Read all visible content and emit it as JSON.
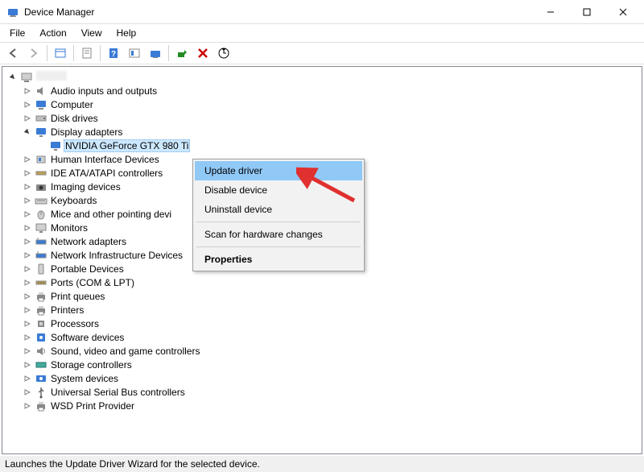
{
  "title": "Device Manager",
  "menus": [
    "File",
    "Action",
    "View",
    "Help"
  ],
  "tree": {
    "root_label": "",
    "items": [
      {
        "label": "Audio inputs and outputs",
        "icon": "speaker-icon"
      },
      {
        "label": "Computer",
        "icon": "computer-icon"
      },
      {
        "label": "Disk drives",
        "icon": "disk-icon"
      },
      {
        "label": "Display adapters",
        "icon": "display-icon",
        "expanded": true,
        "children": [
          {
            "label": "NVIDIA GeForce GTX 980 Ti",
            "icon": "display-icon",
            "selected": true
          }
        ]
      },
      {
        "label": "Human Interface Devices",
        "icon": "hid-icon"
      },
      {
        "label": "IDE ATA/ATAPI controllers",
        "icon": "ide-icon"
      },
      {
        "label": "Imaging devices",
        "icon": "camera-icon"
      },
      {
        "label": "Keyboards",
        "icon": "keyboard-icon"
      },
      {
        "label": "Mice and other pointing devi",
        "icon": "mouse-icon"
      },
      {
        "label": "Monitors",
        "icon": "monitor-icon"
      },
      {
        "label": "Network adapters",
        "icon": "network-icon"
      },
      {
        "label": "Network Infrastructure Devices",
        "icon": "network-icon"
      },
      {
        "label": "Portable Devices",
        "icon": "portable-icon"
      },
      {
        "label": "Ports (COM & LPT)",
        "icon": "port-icon"
      },
      {
        "label": "Print queues",
        "icon": "printer-icon"
      },
      {
        "label": "Printers",
        "icon": "printer-icon"
      },
      {
        "label": "Processors",
        "icon": "cpu-icon"
      },
      {
        "label": "Software devices",
        "icon": "software-icon"
      },
      {
        "label": "Sound, video and game controllers",
        "icon": "sound-icon"
      },
      {
        "label": "Storage controllers",
        "icon": "storage-icon"
      },
      {
        "label": "System devices",
        "icon": "system-icon"
      },
      {
        "label": "Universal Serial Bus controllers",
        "icon": "usb-icon"
      },
      {
        "label": "WSD Print Provider",
        "icon": "printer-icon"
      }
    ]
  },
  "context_menu": {
    "items": [
      {
        "label": "Update driver",
        "highlight": true
      },
      {
        "label": "Disable device"
      },
      {
        "label": "Uninstall device"
      }
    ],
    "items2": [
      {
        "label": "Scan for hardware changes"
      }
    ],
    "items3": [
      {
        "label": "Properties",
        "bold": true
      }
    ]
  },
  "statusbar": "Launches the Update Driver Wizard for the selected device."
}
